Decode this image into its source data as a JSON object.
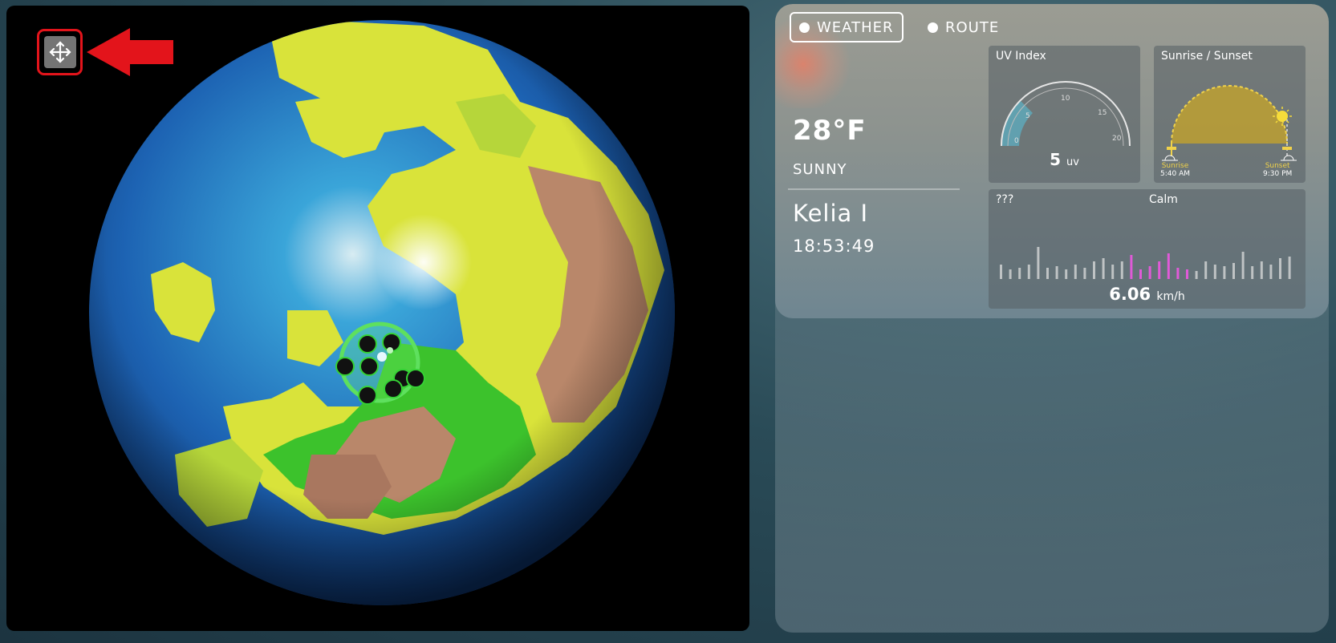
{
  "tabs": {
    "weather": "WEATHER",
    "route": "ROUTE"
  },
  "weather": {
    "temperature": "28°F",
    "condition": "SUNNY",
    "location": "Kelia I",
    "time": "18:53:49"
  },
  "uv": {
    "title": "UV Index",
    "value": "5",
    "unit": "uv",
    "ticks": [
      "0",
      "5",
      "10",
      "15",
      "20"
    ],
    "level": 5,
    "max": 20
  },
  "sun": {
    "title": "Sunrise / Sunset",
    "sunrise_label": "Sunrise",
    "sunrise_time": "5:40 AM",
    "sunset_label": "Sunset",
    "sunset_time": "9:30 PM"
  },
  "wind": {
    "title": "???",
    "status": "Calm",
    "speed": "6.06",
    "unit": "km/h"
  },
  "colors": {
    "accent_red": "#e3141b",
    "uv_fill": "#5fa8b8",
    "sun_arc": "#f0d24a",
    "wind_highlight": "#e05ad8"
  }
}
